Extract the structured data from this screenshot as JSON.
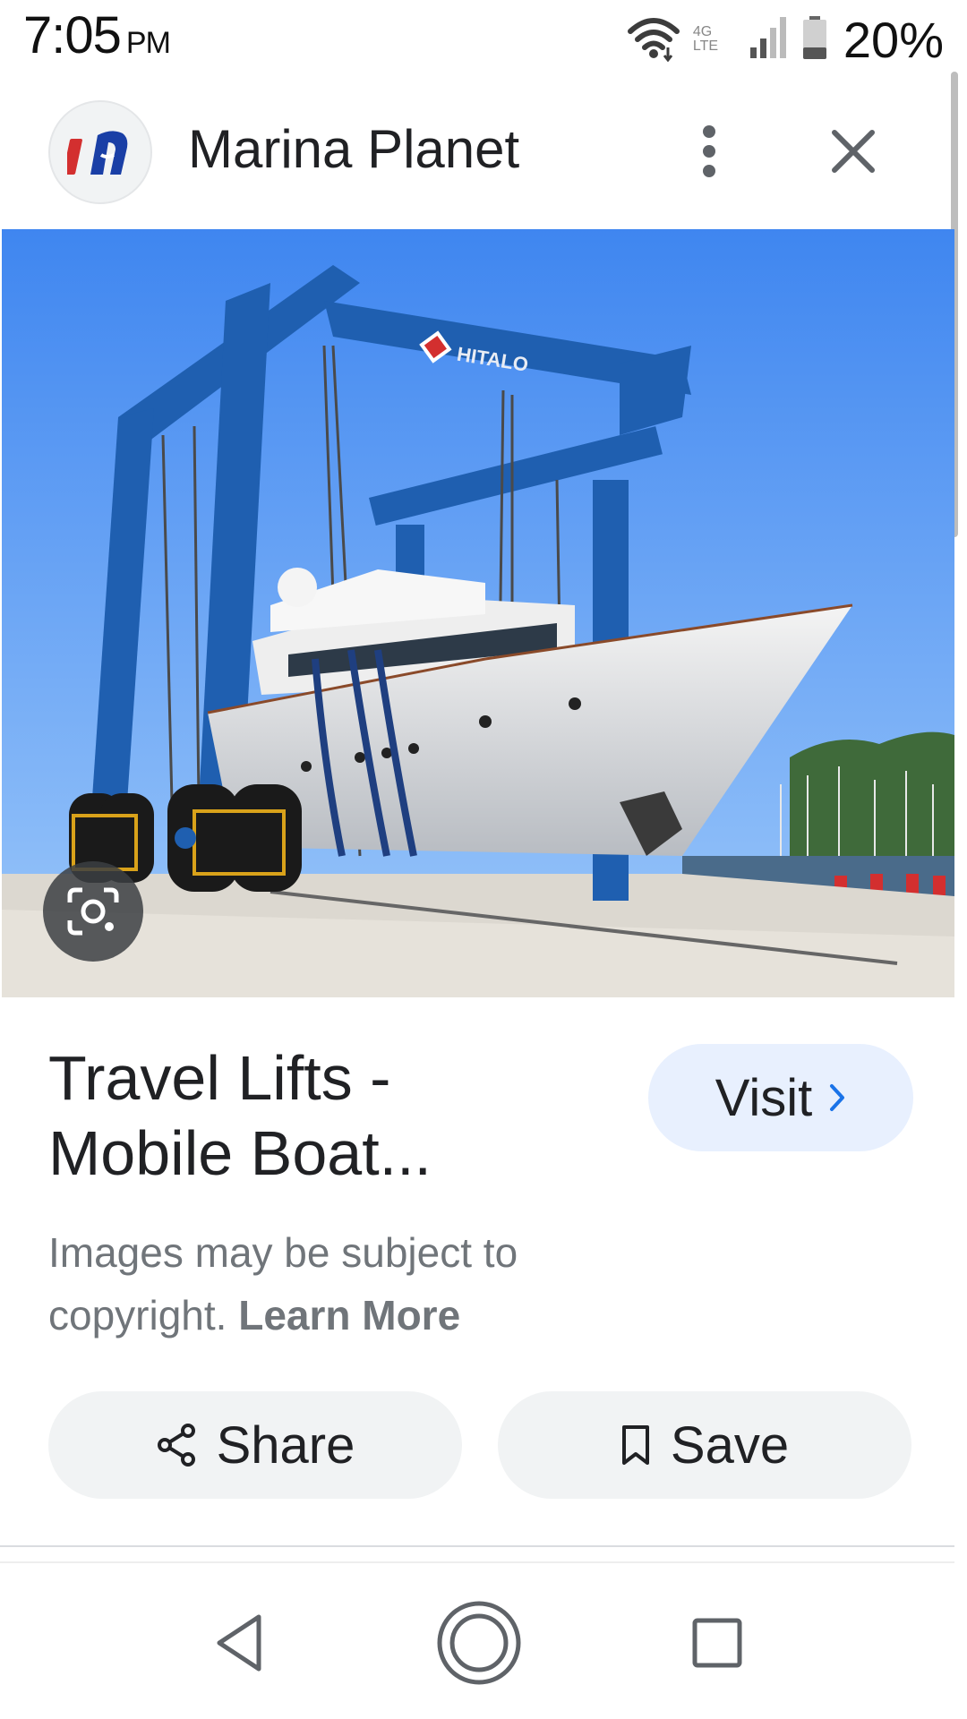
{
  "status_bar": {
    "time": "7:05",
    "ampm": "PM",
    "network": "4G LTE",
    "battery": "20%",
    "icons": [
      "wifi-icon",
      "lte-icon",
      "signal-icon",
      "battery-icon"
    ]
  },
  "header": {
    "site_name": "Marina Planet",
    "logo_icon": "marina-planet-logo",
    "more_icon": "more-vert-icon",
    "close_icon": "close-icon"
  },
  "image": {
    "gantry_label": "HITALO",
    "lens_icon": "lens-search-icon"
  },
  "result": {
    "title_line1": "Travel Lifts -",
    "title_line2": "Mobile Boat...",
    "visit_label": "Visit",
    "visit_icon": "chevron-right-icon"
  },
  "notice": {
    "text": "Images may be subject to copyright.",
    "link": "Learn More"
  },
  "actions": {
    "share_label": "Share",
    "share_icon": "share-icon",
    "save_label": "Save",
    "save_icon": "bookmark-icon"
  },
  "nav": {
    "back_icon": "back-icon",
    "home_icon": "home-icon",
    "recents_icon": "recents-icon"
  },
  "colors": {
    "accent": "#1a73e8",
    "visit_bg": "#e8f0fe",
    "pill_bg": "#f1f3f4",
    "secondary_text": "#70757a",
    "gantry_blue": "#1f5fb0"
  }
}
